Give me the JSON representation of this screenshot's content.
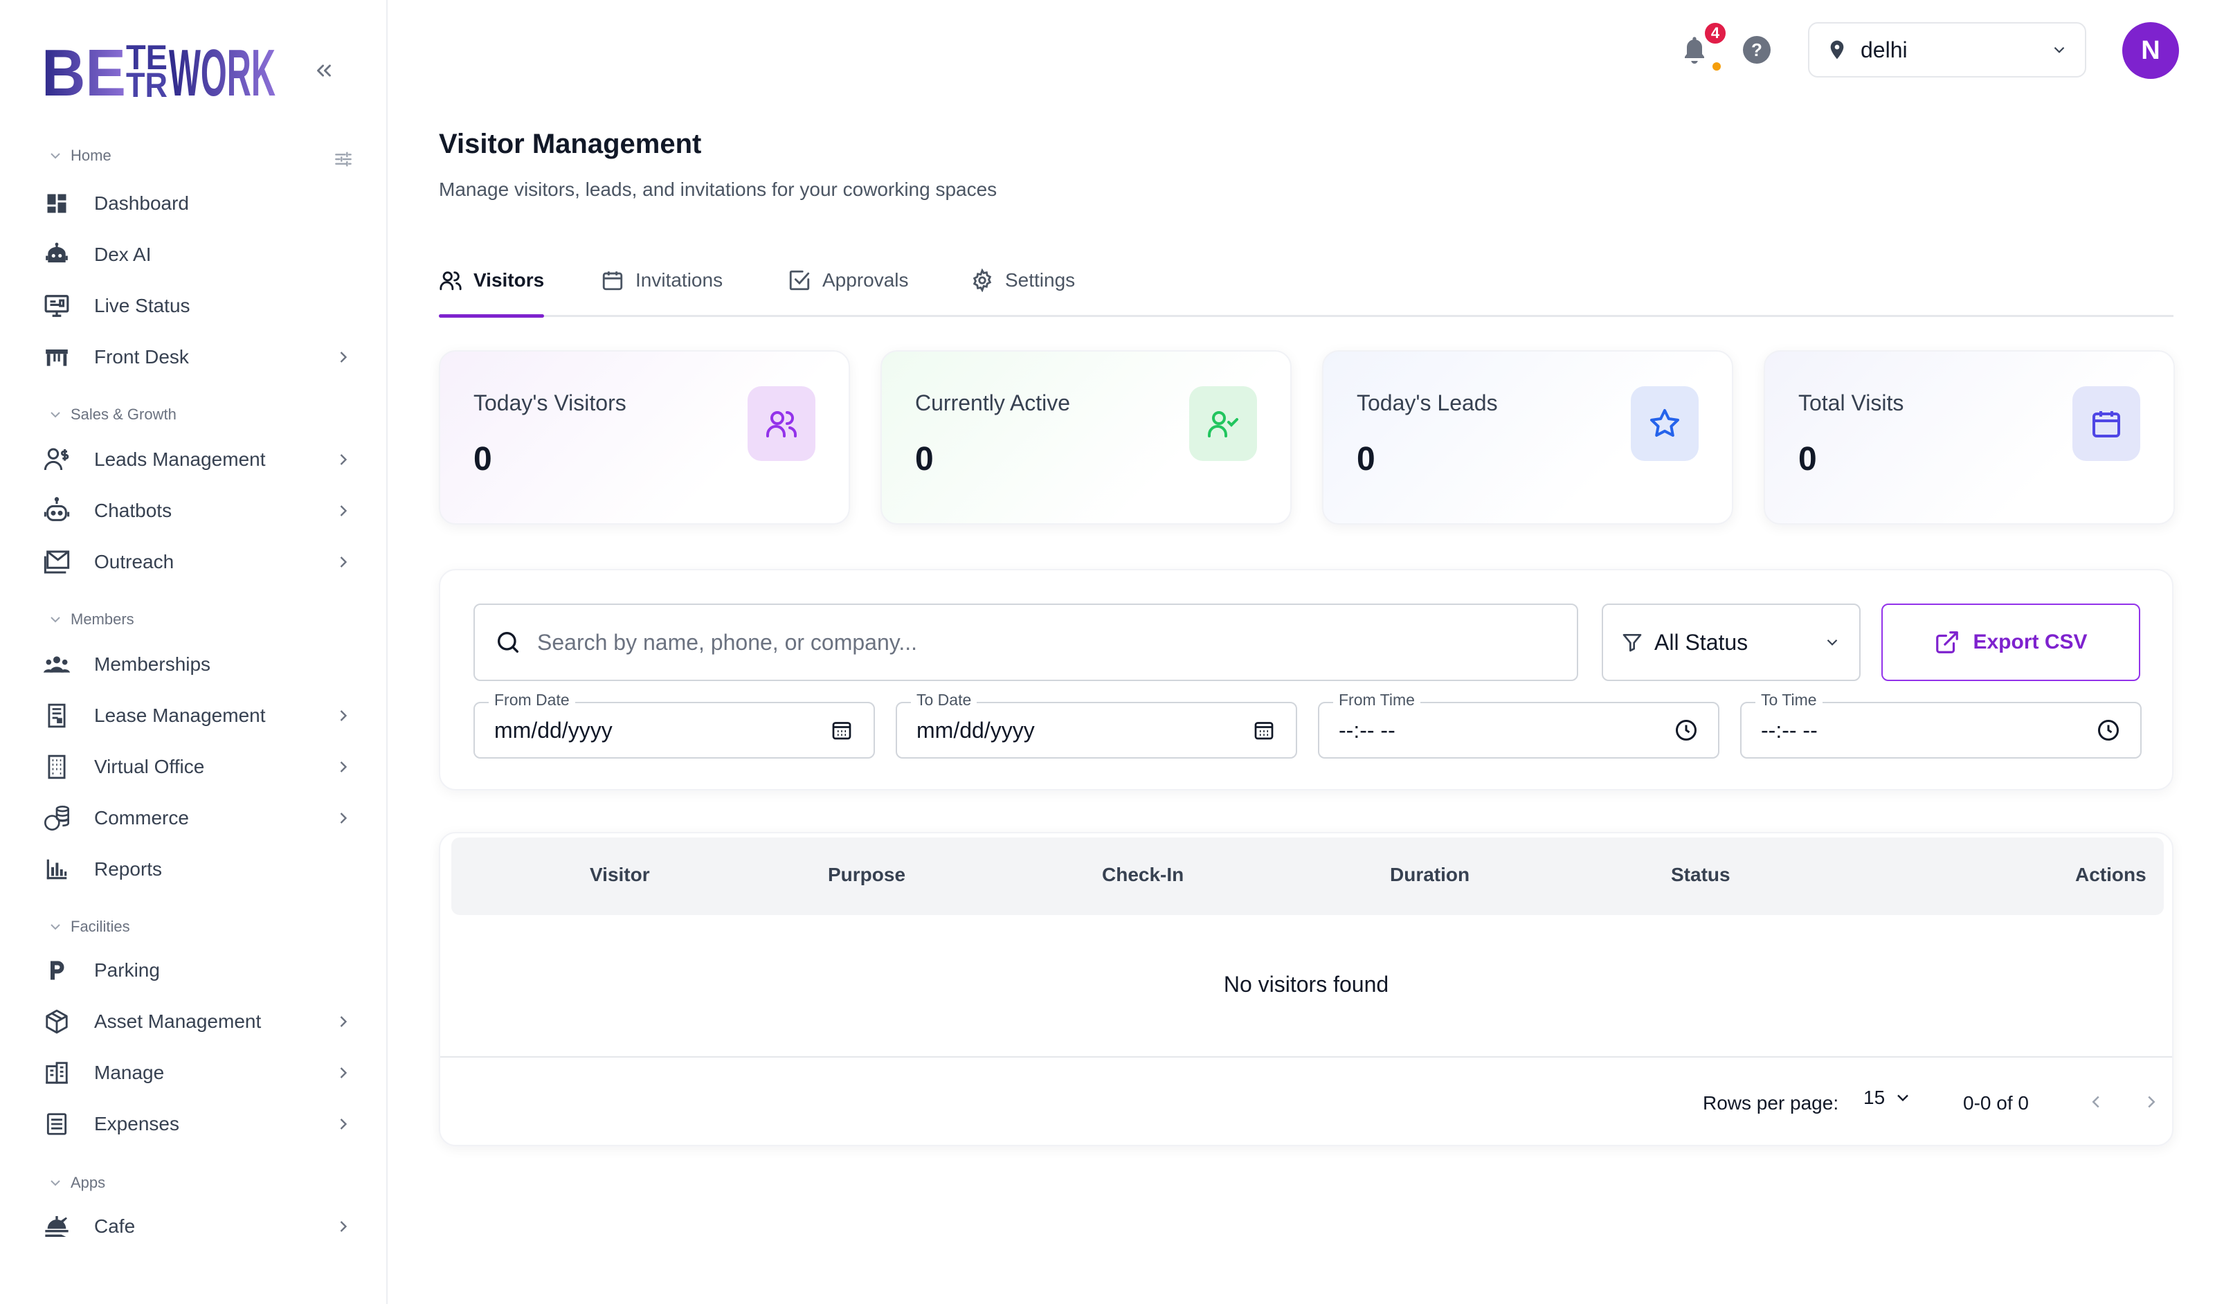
{
  "brand": {
    "logo_text": "BETTERWORK"
  },
  "sidebar": {
    "sections": [
      {
        "label": "Home"
      },
      {
        "label": "Sales & Growth"
      },
      {
        "label": "Members"
      },
      {
        "label": "Facilities"
      },
      {
        "label": "Apps"
      }
    ],
    "items": [
      {
        "label": "Dashboard",
        "icon": "dashboard-icon"
      },
      {
        "label": "Dex AI",
        "icon": "robot-icon"
      },
      {
        "label": "Live Status",
        "icon": "monitor-icon"
      },
      {
        "label": "Front Desk",
        "icon": "front-desk-icon"
      },
      {
        "label": "Leads Management",
        "icon": "person-dollar-icon"
      },
      {
        "label": "Chatbots",
        "icon": "chatbot-icon"
      },
      {
        "label": "Outreach",
        "icon": "mail-icon"
      },
      {
        "label": "Memberships",
        "icon": "group-icon"
      },
      {
        "label": "Lease Management",
        "icon": "document-icon"
      },
      {
        "label": "Virtual Office",
        "icon": "building-icon"
      },
      {
        "label": "Commerce",
        "icon": "coins-icon"
      },
      {
        "label": "Reports",
        "icon": "bar-chart-icon"
      },
      {
        "label": "Parking",
        "icon": "parking-icon"
      },
      {
        "label": "Asset Management",
        "icon": "cube-icon"
      },
      {
        "label": "Manage",
        "icon": "office-building-icon"
      },
      {
        "label": "Expenses",
        "icon": "receipt-icon"
      },
      {
        "label": "Cafe",
        "icon": "food-tray-icon"
      }
    ]
  },
  "header": {
    "notification_count": "4",
    "help_label": "?",
    "location": "delhi",
    "avatar_initial": "N"
  },
  "page": {
    "title": "Visitor Management",
    "subtitle": "Manage visitors, leads, and invitations for your coworking spaces"
  },
  "tabs": [
    {
      "label": "Visitors",
      "active": true
    },
    {
      "label": "Invitations",
      "active": false
    },
    {
      "label": "Approvals",
      "active": false
    },
    {
      "label": "Settings",
      "active": false
    }
  ],
  "stats": [
    {
      "label": "Today's Visitors",
      "value": "0",
      "icon": "users-icon",
      "accent": "#9333ea"
    },
    {
      "label": "Currently Active",
      "value": "0",
      "icon": "user-check-icon",
      "accent": "#22c55e"
    },
    {
      "label": "Today's Leads",
      "value": "0",
      "icon": "star-icon",
      "accent": "#2563eb"
    },
    {
      "label": "Total Visits",
      "value": "0",
      "icon": "calendar-icon",
      "accent": "#4f46e5"
    }
  ],
  "filters": {
    "search_placeholder": "Search by name, phone, or company...",
    "status_value": "All Status",
    "export_label": "Export CSV",
    "from_date_label": "From Date",
    "from_date_value": "mm/dd/yyyy",
    "to_date_label": "To Date",
    "to_date_value": "mm/dd/yyyy",
    "from_time_label": "From Time",
    "from_time_value": "--:-- --",
    "to_time_label": "To Time",
    "to_time_value": "--:-- --"
  },
  "table": {
    "columns": [
      "Visitor",
      "Purpose",
      "Check-In",
      "Duration",
      "Status",
      "Actions"
    ],
    "empty_message": "No visitors found",
    "rows_per_page_label": "Rows per page:",
    "rows_per_page_value": "15",
    "page_info": "0-0 of 0"
  },
  "colors": {
    "accent": "#7e22ce",
    "badge": "#e11d48"
  }
}
